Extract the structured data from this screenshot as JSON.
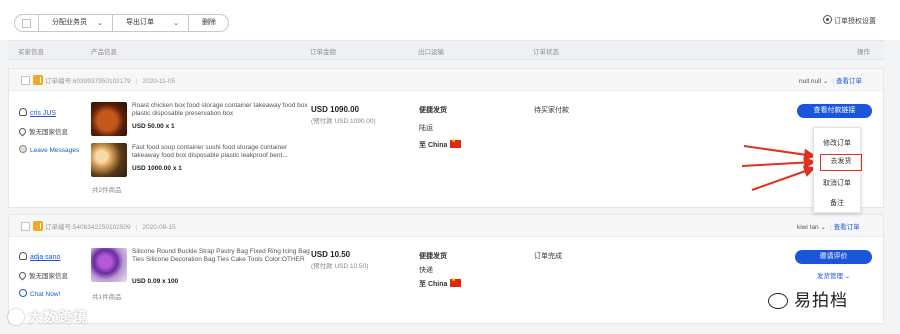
{
  "toolbar": {
    "assign_label": "分配业务员",
    "export_label": "导出订单",
    "delete_label": "删除",
    "settings_label": "订单授权设置"
  },
  "columns": [
    "买家信息",
    "产品信息",
    "订单金额",
    "出口运输",
    "订单状态",
    "操作"
  ],
  "orders": [
    {
      "order_no": "订单编号:6039937950102179",
      "date": "2020-11-05",
      "assignee": "null null",
      "view_link": "查看订单",
      "buyer_name": "cris JUS",
      "buyer_location": "暂无国家信息",
      "buyer_message": "Leave Messages",
      "products": [
        {
          "title": "Roast chicken box food storage container takeaway food box plastic disposable preservation box",
          "price": "USD 50.00 x 1"
        },
        {
          "title": "Fast food soup container sushi food storage container takeaway food box disposable plastic leakproof bent...",
          "price": "USD 1000.00 x 1"
        }
      ],
      "item_count": "共2件商品",
      "amount": "USD 1090.00",
      "amount_sub": "(预付款 USD 1090.00)",
      "ship_method": "便捷发货",
      "ship_mode": "陆运",
      "ship_dest": "至 China",
      "status": "待买家付款",
      "primary_action": "查看付款链接"
    },
    {
      "order_no": "订单编号:5408342250102509",
      "date": "2020-09-15",
      "assignee": "kiwi tan",
      "view_link": "查看订单",
      "buyer_name": "adja sano",
      "buyer_location": "暂无国家信息",
      "buyer_message": "Chat Now!",
      "products": [
        {
          "title": "Silicone Round Buckle Strap Pastry Bag Fixed Ring Icing Bag Ties Silicone Decoration Bag Ties Cake Tools Color:OTHER",
          "price": "USD 0.09 x 100"
        }
      ],
      "item_count": "共1件商品",
      "amount": "USD 10.50",
      "amount_sub": "(预付款 USD 10.50)",
      "ship_method": "便捷发货",
      "ship_mode": "快递",
      "ship_dest": "至 China",
      "status": "订单完成",
      "primary_action": "邀请评价",
      "secondary_action": "发货管理"
    }
  ],
  "dropdown_menu": [
    "修改订单",
    "去发货",
    "取消订单",
    "备注"
  ],
  "watermark_left": "大数跨境",
  "watermark_right": "易拍档",
  "colors": {
    "accent_blue": "#1a56db",
    "arrow_red": "#e0301e",
    "badge_orange": "#f5a623"
  }
}
